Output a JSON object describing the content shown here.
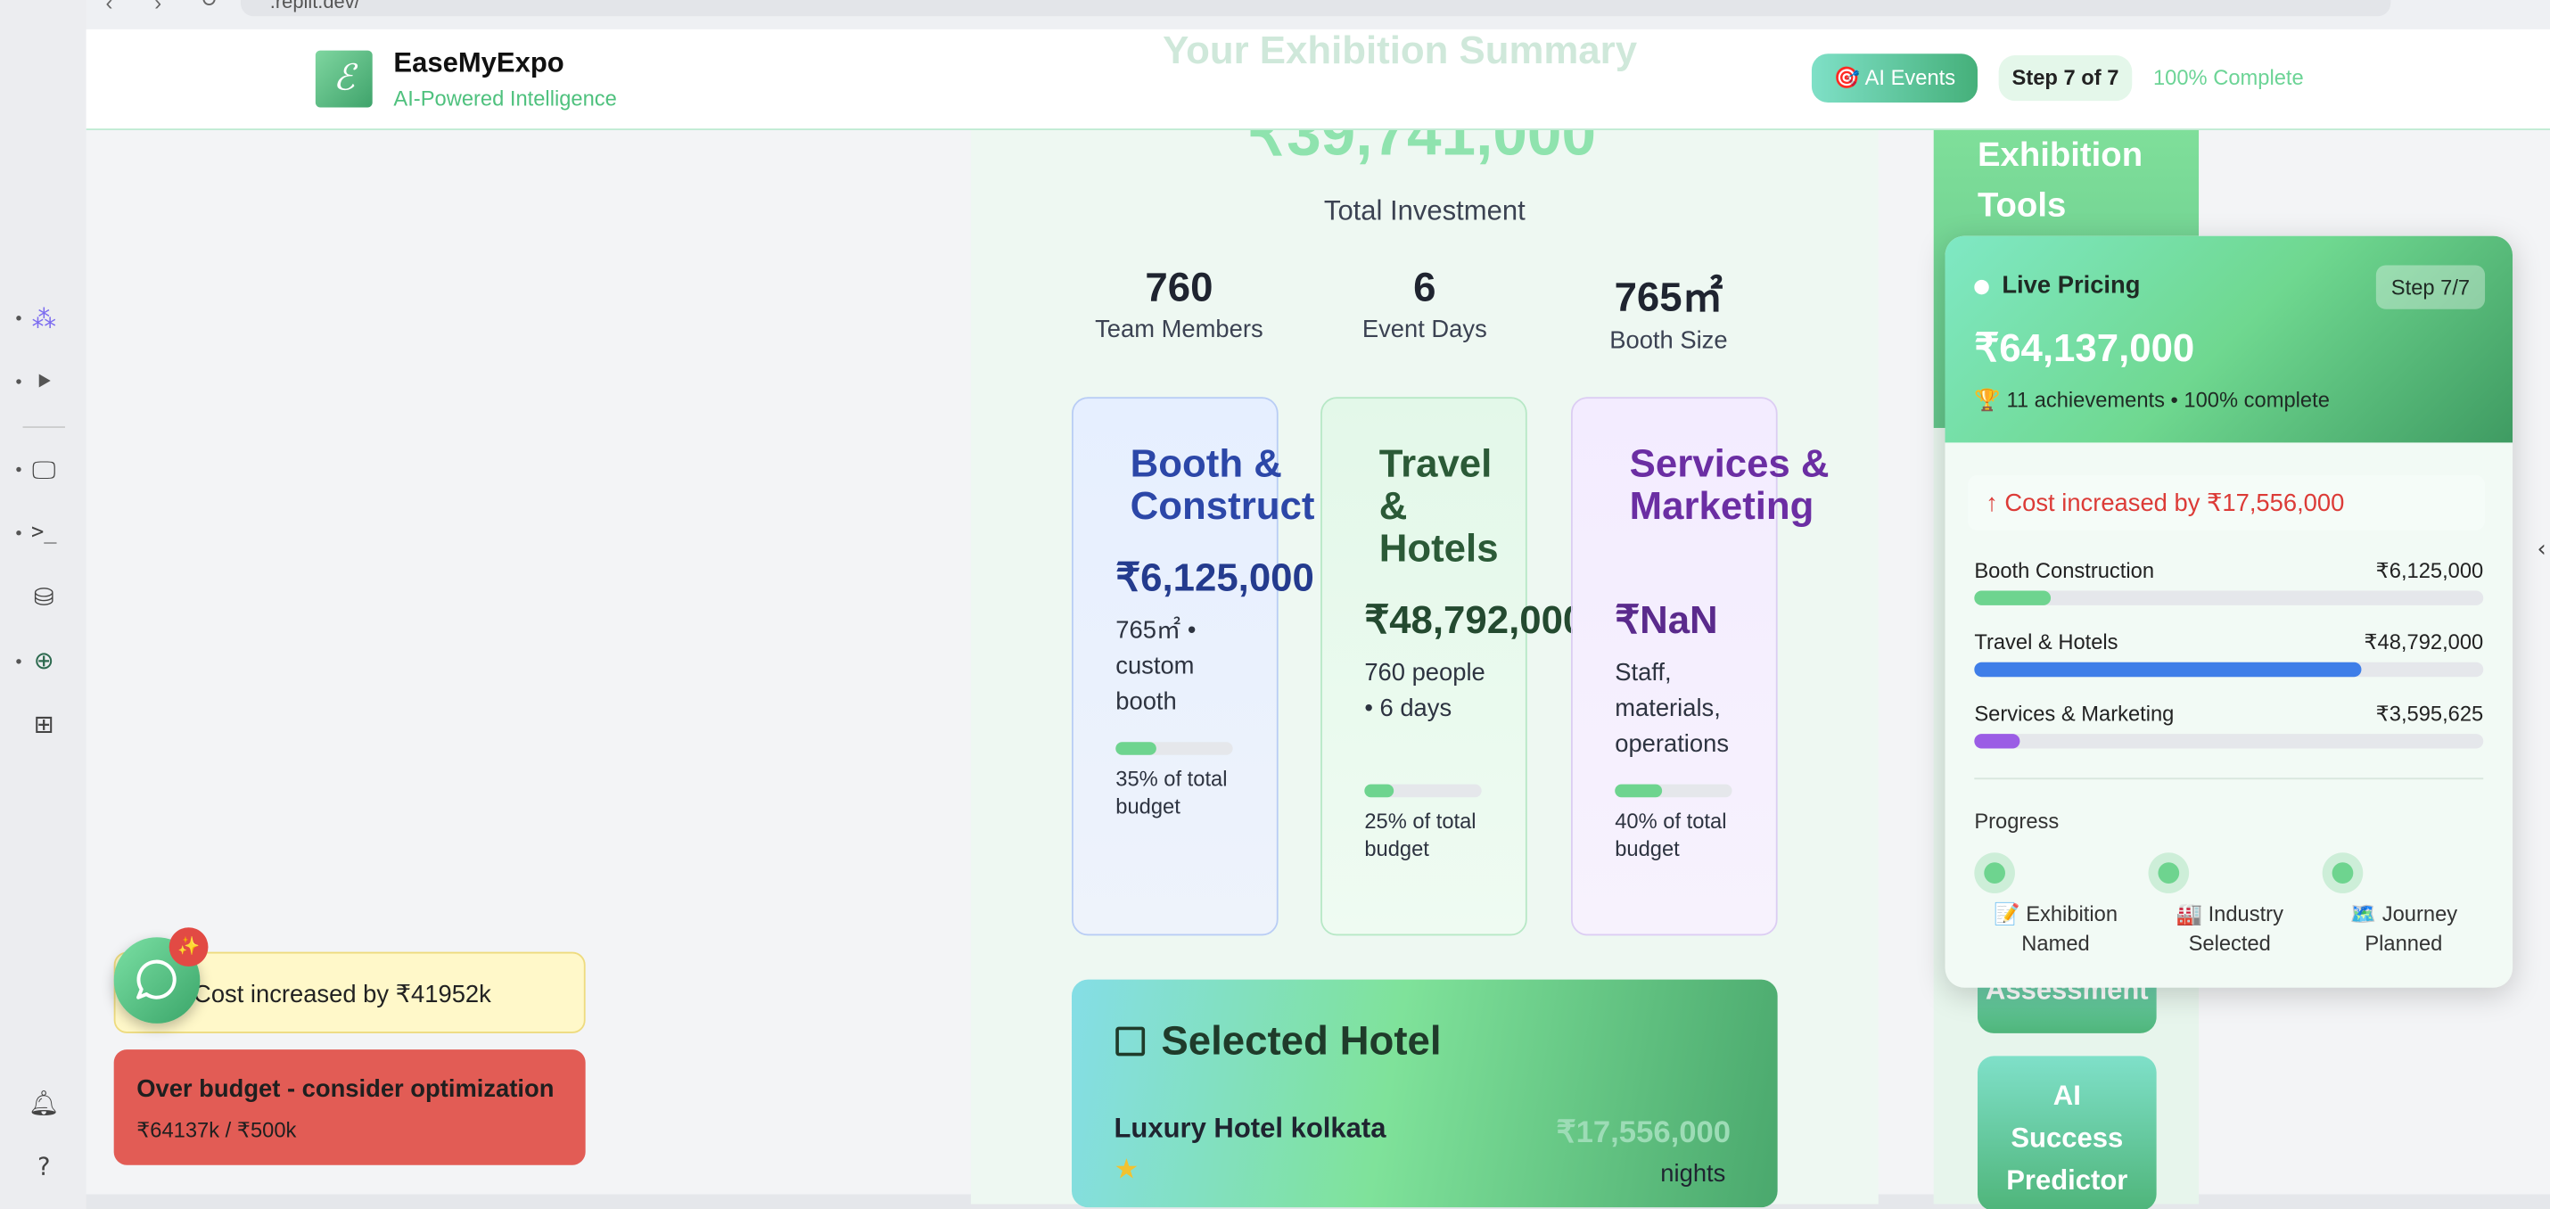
{
  "browser": {
    "url": ".replit.dev/"
  },
  "header": {
    "brand": "EaseMyExpo",
    "tagline": "AI-Powered Intelligence",
    "ai_button": "🎯 AI Events",
    "step": "Step 7 of 7",
    "complete": "100% Complete",
    "faded_title": "Your Exhibition Summary"
  },
  "summary": {
    "total_amount": "₹39,741,000",
    "total_label": "Total Investment",
    "stats": [
      {
        "value": "760",
        "label": "Team Members"
      },
      {
        "value": "6",
        "label": "Event Days"
      },
      {
        "value": "765㎡",
        "label": "Booth Size"
      }
    ]
  },
  "breakdown": [
    {
      "title": "Booth & Construct",
      "amount": "₹6,125,000",
      "desc": "765㎡ • custom booth",
      "pct_label": "35% of total budget",
      "pct": 35
    },
    {
      "title": "Travel & Hotels",
      "amount": "₹48,792,000",
      "desc": "760 people • 6 days",
      "pct_label": "25% of total budget",
      "pct": 25
    },
    {
      "title": "Services & Marketing",
      "amount": "₹NaN",
      "desc": "Staff, materials, operations",
      "pct_label": "40% of total budget",
      "pct": 40
    }
  ],
  "hotel": {
    "section_title": "Selected Hotel",
    "name": "Luxury Hotel kolkata",
    "price": "₹17,556,000",
    "nights": "nights"
  },
  "tools": {
    "title_line1": "Exhibition",
    "title_line2": "Tools",
    "assessment": "Assessment",
    "predictor_line1": "AI",
    "predictor_line2": "Success",
    "predictor_line3": "Predictor"
  },
  "live_pricing": {
    "title": "Live Pricing",
    "step": "Step 7/7",
    "total": "₹64,137,000",
    "achievements": "🏆 11 achievements • 100% complete",
    "cost_alert": "↑ Cost increased by ₹17,556,000",
    "items": [
      {
        "label": "Booth Construction",
        "value": "₹6,125,000",
        "fill": 0.15,
        "color": "#6ed48f"
      },
      {
        "label": "Travel & Hotels",
        "value": "₹48,792,000",
        "fill": 0.76,
        "color": "#3f7ee8"
      },
      {
        "label": "Services & Marketing",
        "value": "₹3,595,625",
        "fill": 0.09,
        "color": "#9b5de5"
      }
    ],
    "progress_label": "Progress",
    "milestones": [
      {
        "icon": "📝",
        "line1": "Exhibition",
        "line2": "Named"
      },
      {
        "icon": "🏭",
        "line1": "Industry",
        "line2": "Selected"
      },
      {
        "icon": "🗺️",
        "line1": "Journey",
        "line2": "Planned"
      }
    ]
  },
  "toasts": {
    "cost": "Cost increased by ₹41952k",
    "budget_title": "Over budget - consider optimization",
    "budget_detail": "₹64137k / ₹500k"
  },
  "chat_badge": "✨"
}
